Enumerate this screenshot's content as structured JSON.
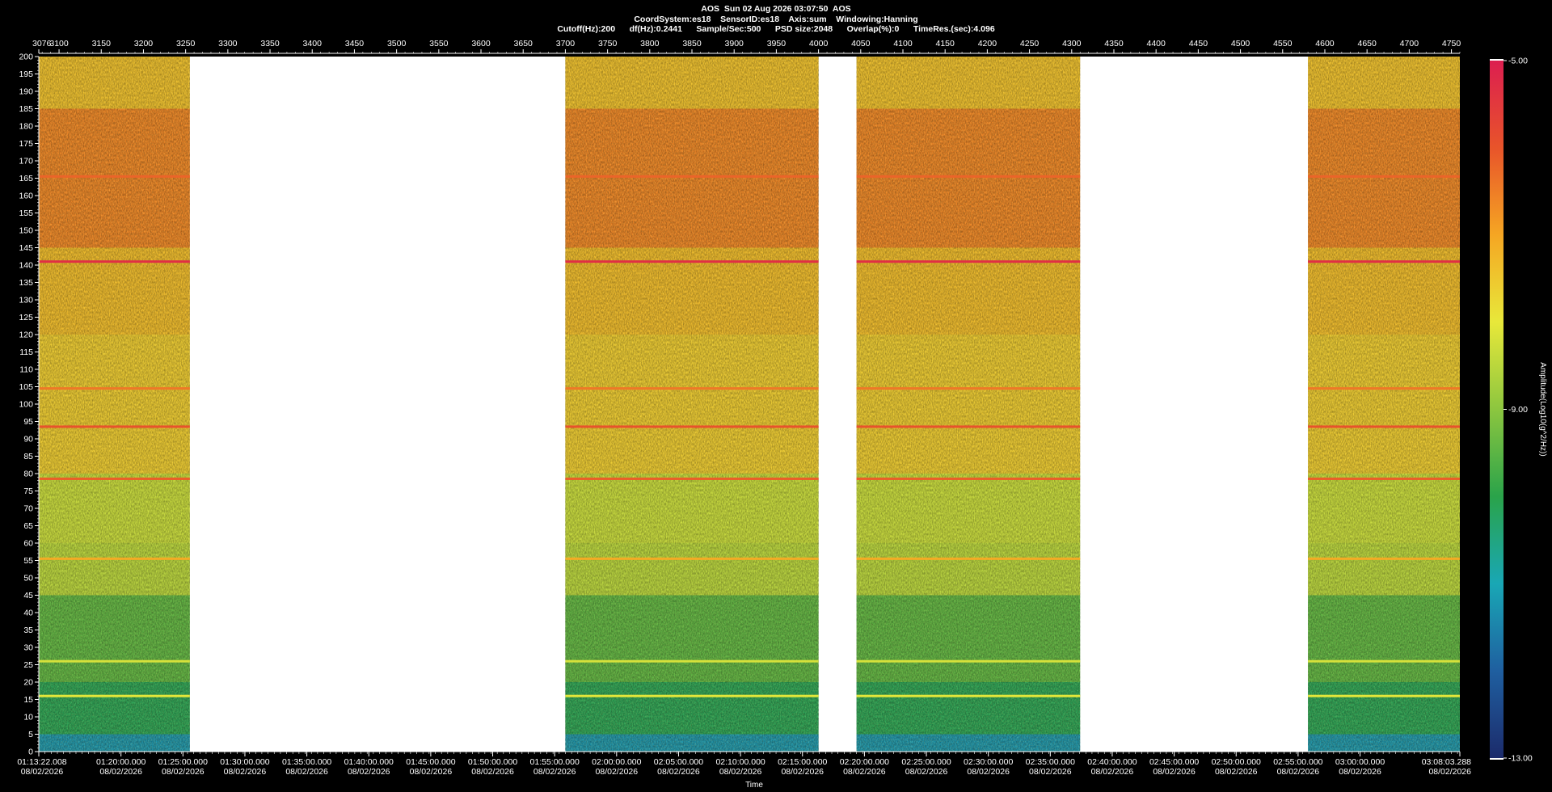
{
  "header": {
    "line1": "AOS  Sun 02 Aug 2026 03:07:50  AOS",
    "line2": "CoordSystem:es18    SensorID:es18    Axis:sum    Windowing:Hanning",
    "line3": "Cutoff(Hz):200      df(Hz):0.2441      Sample/Sec:500      PSD size:2048      Overlap(%):0      TimeRes.(sec):4.096"
  },
  "chart_data": {
    "type": "heatmap",
    "title": "AOS  Sun 02 Aug 2026 03:07:50  AOS",
    "xlabel": "Time",
    "ylabel": "",
    "colorbar_label": "Amplitude(Log10(g^2/Hz))",
    "colorbar_range": [
      -13.0,
      -5.0
    ],
    "colorbar_ticks": [
      "-5.00",
      "-9.00",
      "-13.00"
    ],
    "colormap": [
      "#1c2b6b",
      "#1f5fa0",
      "#19a7b5",
      "#2aa34a",
      "#8cc63f",
      "#e8e83a",
      "#f5a623",
      "#e8542a",
      "#dc1e50"
    ],
    "ylim": [
      0,
      200
    ],
    "y_ticks": [
      0,
      5,
      10,
      15,
      20,
      25,
      30,
      35,
      40,
      45,
      50,
      55,
      60,
      65,
      70,
      75,
      80,
      85,
      90,
      95,
      100,
      105,
      110,
      115,
      120,
      125,
      130,
      135,
      140,
      145,
      150,
      155,
      160,
      165,
      170,
      175,
      180,
      185,
      190,
      195,
      200
    ],
    "top_axis_range": [
      3076,
      4760
    ],
    "top_ticks": [
      "3076",
      "3100",
      "3150",
      "3200",
      "3250",
      "3300",
      "3350",
      "3400",
      "3450",
      "3500",
      "3550",
      "3600",
      "3650",
      "3700",
      "3750",
      "3800",
      "3850",
      "3900",
      "3950",
      "4000",
      "4050",
      "4100",
      "4150",
      "4200",
      "4250",
      "4300",
      "4350",
      "4400",
      "4450",
      "4500",
      "4550",
      "4600",
      "4650",
      "4700",
      "4750"
    ],
    "time_range_sec": [
      0,
      6881.28
    ],
    "time_ticks": [
      {
        "t": 0,
        "time": "01:13:22.008",
        "date": "08/02/2026"
      },
      {
        "t": 397.992,
        "time": "01:20:00.000",
        "date": "08/02/2026"
      },
      {
        "t": 697.992,
        "time": "01:25:00.000",
        "date": "08/02/2026"
      },
      {
        "t": 997.992,
        "time": "01:30:00.000",
        "date": "08/02/2026"
      },
      {
        "t": 1297.992,
        "time": "01:35:00.000",
        "date": "08/02/2026"
      },
      {
        "t": 1597.992,
        "time": "01:40:00.000",
        "date": "08/02/2026"
      },
      {
        "t": 1897.992,
        "time": "01:45:00.000",
        "date": "08/02/2026"
      },
      {
        "t": 2197.992,
        "time": "01:50:00.000",
        "date": "08/02/2026"
      },
      {
        "t": 2497.992,
        "time": "01:55:00.000",
        "date": "08/02/2026"
      },
      {
        "t": 2797.992,
        "time": "02:00:00.000",
        "date": "08/02/2026"
      },
      {
        "t": 3097.992,
        "time": "02:05:00.000",
        "date": "08/02/2026"
      },
      {
        "t": 3397.992,
        "time": "02:10:00.000",
        "date": "08/02/2026"
      },
      {
        "t": 3697.992,
        "time": "02:15:00.000",
        "date": "08/02/2026"
      },
      {
        "t": 3997.992,
        "time": "02:20:00.000",
        "date": "08/02/2026"
      },
      {
        "t": 4297.992,
        "time": "02:25:00.000",
        "date": "08/02/2026"
      },
      {
        "t": 4597.992,
        "time": "02:30:00.000",
        "date": "08/02/2026"
      },
      {
        "t": 4897.992,
        "time": "02:35:00.000",
        "date": "08/02/2026"
      },
      {
        "t": 5197.992,
        "time": "02:40:00.000",
        "date": "08/02/2026"
      },
      {
        "t": 5497.992,
        "time": "02:45:00.000",
        "date": "08/02/2026"
      },
      {
        "t": 5797.992,
        "time": "02:50:00.000",
        "date": "08/02/2026"
      },
      {
        "t": 6097.992,
        "time": "02:55:00.000",
        "date": "08/02/2026"
      },
      {
        "t": 6397.992,
        "time": "03:00:00.000",
        "date": "08/02/2026"
      },
      {
        "t": 6881.28,
        "time": "03:08:03.288",
        "date": "08/02/2026"
      }
    ],
    "data_segments_top_axis": [
      [
        3076,
        3255
      ],
      [
        3700,
        4000
      ],
      [
        4045,
        4310
      ],
      [
        4580,
        4760
      ]
    ],
    "spectral_bands": [
      {
        "f0": 0,
        "f1": 5,
        "level": 0.22
      },
      {
        "f0": 5,
        "f1": 20,
        "level": 0.36
      },
      {
        "f0": 20,
        "f1": 45,
        "level": 0.44
      },
      {
        "f0": 45,
        "f1": 60,
        "level": 0.56
      },
      {
        "f0": 60,
        "f1": 80,
        "level": 0.58
      },
      {
        "f0": 80,
        "f1": 120,
        "level": 0.68
      },
      {
        "f0": 120,
        "f1": 145,
        "level": 0.71
      },
      {
        "f0": 145,
        "f1": 185,
        "level": 0.8
      },
      {
        "f0": 185,
        "f1": 200,
        "level": 0.7
      }
    ],
    "tonal_lines_hz": [
      {
        "f": 141,
        "level": 0.96
      },
      {
        "f": 93.5,
        "level": 0.88
      },
      {
        "f": 78.5,
        "level": 0.86
      },
      {
        "f": 55.5,
        "level": 0.74
      },
      {
        "f": 104.5,
        "level": 0.82
      },
      {
        "f": 165.5,
        "level": 0.85
      },
      {
        "f": 26,
        "level": 0.6
      },
      {
        "f": 16,
        "level": 0.62
      }
    ],
    "grid": false
  }
}
